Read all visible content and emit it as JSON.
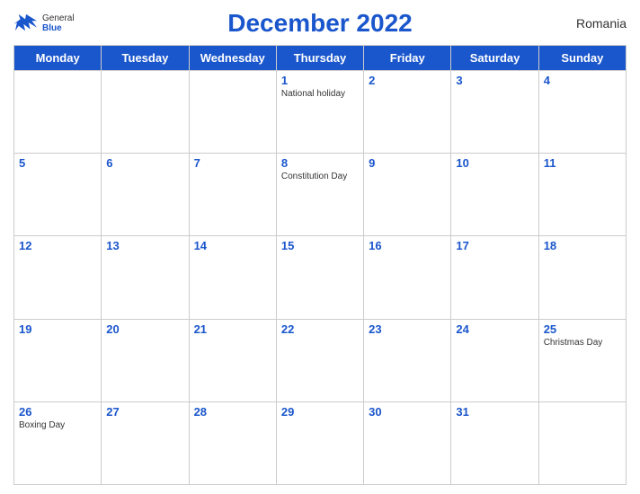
{
  "header": {
    "title": "December 2022",
    "country": "Romania",
    "logo_general": "General",
    "logo_blue": "Blue"
  },
  "weekdays": [
    "Monday",
    "Tuesday",
    "Wednesday",
    "Thursday",
    "Friday",
    "Saturday",
    "Sunday"
  ],
  "weeks": [
    [
      {
        "day": null,
        "holiday": null
      },
      {
        "day": null,
        "holiday": null
      },
      {
        "day": null,
        "holiday": null
      },
      {
        "day": "1",
        "holiday": "National holiday"
      },
      {
        "day": "2",
        "holiday": null
      },
      {
        "day": "3",
        "holiday": null
      },
      {
        "day": "4",
        "holiday": null
      }
    ],
    [
      {
        "day": "5",
        "holiday": null
      },
      {
        "day": "6",
        "holiday": null
      },
      {
        "day": "7",
        "holiday": null
      },
      {
        "day": "8",
        "holiday": "Constitution Day"
      },
      {
        "day": "9",
        "holiday": null
      },
      {
        "day": "10",
        "holiday": null
      },
      {
        "day": "11",
        "holiday": null
      }
    ],
    [
      {
        "day": "12",
        "holiday": null
      },
      {
        "day": "13",
        "holiday": null
      },
      {
        "day": "14",
        "holiday": null
      },
      {
        "day": "15",
        "holiday": null
      },
      {
        "day": "16",
        "holiday": null
      },
      {
        "day": "17",
        "holiday": null
      },
      {
        "day": "18",
        "holiday": null
      }
    ],
    [
      {
        "day": "19",
        "holiday": null
      },
      {
        "day": "20",
        "holiday": null
      },
      {
        "day": "21",
        "holiday": null
      },
      {
        "day": "22",
        "holiday": null
      },
      {
        "day": "23",
        "holiday": null
      },
      {
        "day": "24",
        "holiday": null
      },
      {
        "day": "25",
        "holiday": "Christmas Day"
      }
    ],
    [
      {
        "day": "26",
        "holiday": "Boxing Day"
      },
      {
        "day": "27",
        "holiday": null
      },
      {
        "day": "28",
        "holiday": null
      },
      {
        "day": "29",
        "holiday": null
      },
      {
        "day": "30",
        "holiday": null
      },
      {
        "day": "31",
        "holiday": null
      },
      {
        "day": null,
        "holiday": null
      }
    ]
  ]
}
